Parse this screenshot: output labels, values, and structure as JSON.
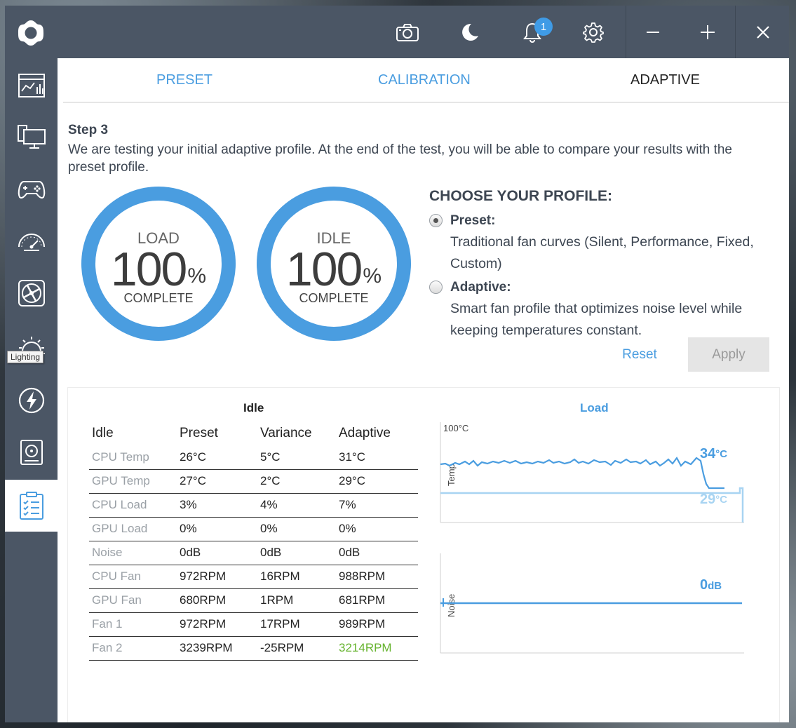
{
  "titlebar": {
    "notification_count": "1"
  },
  "sidebar": {
    "tooltip": "Lighting"
  },
  "tabs": [
    {
      "label": "PRESET"
    },
    {
      "label": "CALIBRATION"
    },
    {
      "label": "ADAPTIVE"
    }
  ],
  "step": {
    "title": "Step 3",
    "description": "We are testing your initial adaptive profile. At the end of the test, you will be able to compare your results with the preset profile."
  },
  "gauges": [
    {
      "title": "LOAD",
      "value": "100",
      "unit": "%",
      "sub": "COMPLETE",
      "progress": 1.0
    },
    {
      "title": "IDLE",
      "value": "100",
      "unit": "%",
      "sub": "COMPLETE",
      "progress": 1.0
    }
  ],
  "profile": {
    "heading": "CHOOSE YOUR PROFILE:",
    "options": [
      {
        "title": "Preset:",
        "desc": "Traditional fan curves (Silent, Performance, Fixed, Custom)",
        "selected": true
      },
      {
        "title": "Adaptive:",
        "desc": "Smart fan profile that optimizes noise level while keeping temperatures constant.",
        "selected": false
      }
    ],
    "reset_label": "Reset",
    "apply_label": "Apply"
  },
  "results": {
    "caption": "Idle",
    "headers": [
      "Idle",
      "Preset",
      "Variance",
      "Adaptive"
    ],
    "rows": [
      [
        "CPU Temp",
        "26°C",
        "5°C",
        "31°C"
      ],
      [
        "GPU Temp",
        "27°C",
        "2°C",
        "29°C"
      ],
      [
        "CPU Load",
        "3%",
        "4%",
        "7%"
      ],
      [
        "GPU Load",
        "0%",
        "0%",
        "0%"
      ],
      [
        "Noise",
        "0dB",
        "0dB",
        "0dB"
      ],
      [
        "CPU Fan",
        "972RPM",
        "16RPM",
        "988RPM"
      ],
      [
        "GPU Fan",
        "680RPM",
        "1RPM",
        "681RPM"
      ],
      [
        "Fan 1",
        "972RPM",
        "17RPM",
        "989RPM"
      ],
      [
        "Fan 2",
        "3239RPM",
        "-25RPM",
        "3214RPM"
      ]
    ],
    "highlight_color": "#66b32e"
  },
  "charts": {
    "caption": "Load",
    "temp": {
      "axis_top_label": "100°C",
      "axis_label": "Temp",
      "current_value": "34",
      "current_unit": "°C",
      "baseline_value": "29",
      "baseline_unit": "°C"
    },
    "noise": {
      "axis_label": "Noise",
      "current_value": "0",
      "current_unit": "dB"
    }
  },
  "colors": {
    "accent": "#4a9de0",
    "gauge": "#4a9de0",
    "light_line": "#a8d4f2",
    "sidebar": "#4b5665"
  }
}
